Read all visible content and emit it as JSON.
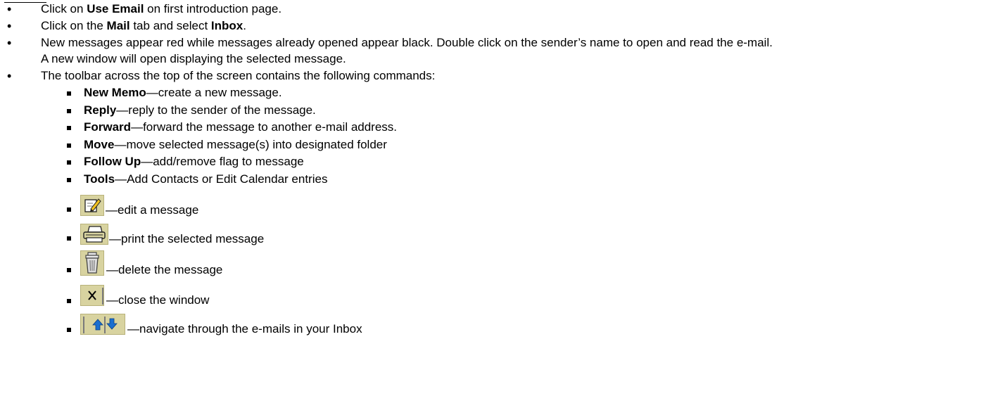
{
  "bullets": [
    {
      "parts": [
        "Click on ",
        "Use Email",
        " on first introduction page."
      ]
    },
    {
      "parts": [
        "Click on the ",
        "Mail",
        " tab and select ",
        "Inbox",
        "."
      ]
    },
    {
      "line1": "New messages appear red while messages already opened appear black. Double click on the sender’s name to open and read the e-mail.",
      "line2": "A new window will open displaying the selected message."
    },
    {
      "text": "The toolbar across the top of the screen contains the following commands:"
    }
  ],
  "commands": [
    {
      "name": "New Memo",
      "desc": "—create a new message."
    },
    {
      "name": "Reply",
      "desc": "—reply to the sender of the message."
    },
    {
      "name": "Forward",
      "desc": "—forward the message to another e-mail address."
    },
    {
      "name": "Move",
      "desc": "—move selected message(s) into designated folder"
    },
    {
      "name": "Follow Up",
      "desc": "—add/remove flag to message"
    },
    {
      "name": "Tools",
      "desc": "—Add Contacts or Edit Calendar entries"
    }
  ],
  "icon_commands": [
    {
      "icon": "edit-icon",
      "desc": "—edit a message"
    },
    {
      "icon": "print-icon",
      "desc": "—print the selected message"
    },
    {
      "icon": "delete-icon",
      "desc": "—delete the message"
    },
    {
      "icon": "close-icon",
      "desc": "—close the window"
    },
    {
      "icon": "navigate-arrows-icon",
      "desc": "—navigate through the e-mails in your Inbox"
    }
  ],
  "colors": {
    "icon_bg": "#d8d3a0",
    "arrow_blue": "#1a6fd0",
    "text": "#000000"
  }
}
